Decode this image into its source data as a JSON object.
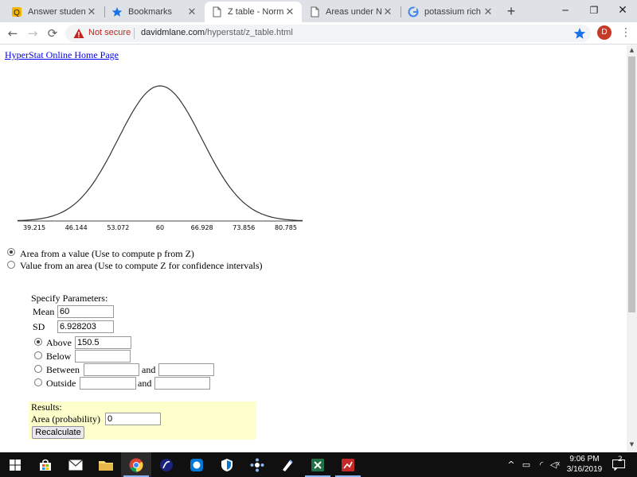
{
  "browser": {
    "tabs": [
      {
        "title": "Answer students' ",
        "icon": "answer-site-icon"
      },
      {
        "title": "Bookmarks",
        "icon": "star-icon"
      },
      {
        "title": "Z table - Normal I",
        "icon": "page-icon",
        "active": true
      },
      {
        "title": "Areas under Norm",
        "icon": "page-icon"
      },
      {
        "title": "potassium rich fo",
        "icon": "google-icon"
      }
    ],
    "security_label": "Not secure",
    "url_host": "davidmlane.com",
    "url_path": "/hyperstat/z_table.html",
    "avatar_letter": "D"
  },
  "page": {
    "home_link": "HyperStat Online Home Page",
    "distribution": {
      "mean": 60,
      "sd": 6.928203,
      "tick_labels": [
        "39.215",
        "46.144",
        "53.072",
        "60",
        "66.928",
        "73.856",
        "80.785"
      ]
    },
    "mode_options": [
      {
        "label": "Area from a value (Use to compute p from Z)",
        "checked": true
      },
      {
        "label": "Value from an area (Use to compute Z for confidence intervals)",
        "checked": false
      }
    ],
    "params_title": "Specify Parameters:",
    "mean_label": "Mean",
    "mean_value": "60",
    "sd_label": "SD",
    "sd_value": "6.928203",
    "above_label": "Above",
    "above_value": "150.5",
    "below_label": "Below",
    "between_label": "Between",
    "outside_label": "Outside",
    "and_label": "and",
    "results_title": "Results:",
    "area_label": "Area (probability)",
    "area_value": "0",
    "recalc_label": "Recalculate"
  },
  "taskbar": {
    "time": "9:06 PM",
    "date": "3/16/2019",
    "notification_count": "2"
  }
}
